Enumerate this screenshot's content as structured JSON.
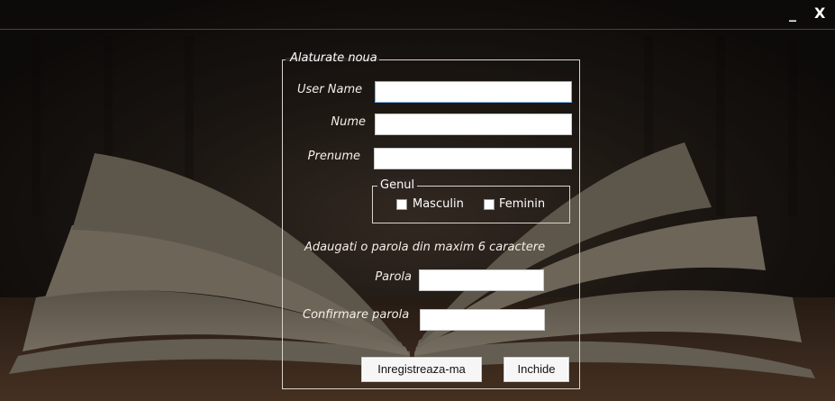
{
  "window": {
    "minimize_label": "_",
    "close_label": "X"
  },
  "form": {
    "legend": "Alaturate noua",
    "username": {
      "label": "User Name",
      "value": ""
    },
    "nume": {
      "label": "Nume",
      "value": ""
    },
    "prenume": {
      "label": "Prenume",
      "value": ""
    },
    "genul": {
      "legend": "Genul",
      "options": [
        {
          "label": "Masculin",
          "checked": false
        },
        {
          "label": "Feminin",
          "checked": false
        }
      ]
    },
    "password_hint": "Adaugati o parola din maxim 6 caractere",
    "parola": {
      "label": "Parola",
      "value": ""
    },
    "confirmare": {
      "label": "Confirmare parola",
      "value": ""
    },
    "register_button": "Inregistreaza-ma",
    "close_button": "Inchide"
  },
  "colors": {
    "background": "#1a1512",
    "border": "#d9d4cc",
    "input_focus_border": "#7ab0e0"
  }
}
